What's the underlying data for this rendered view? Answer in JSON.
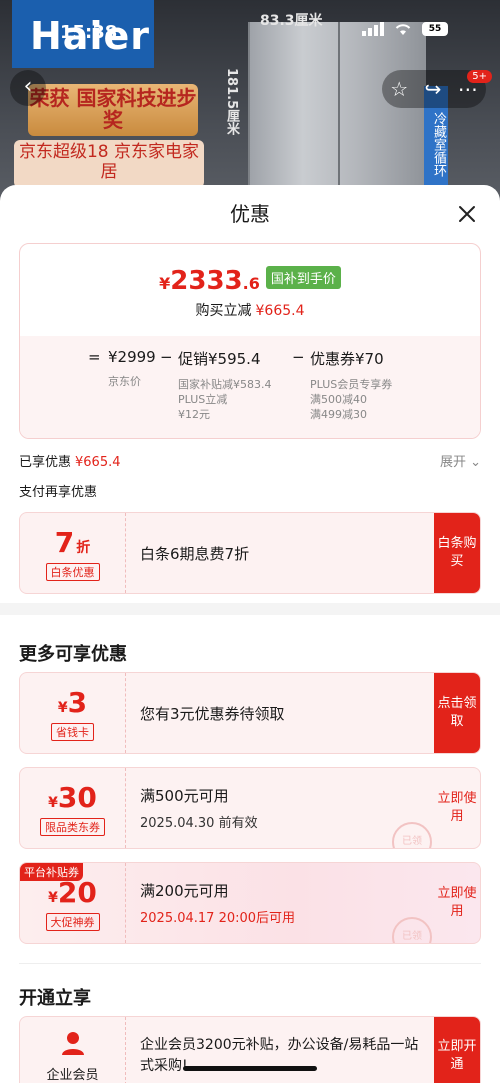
{
  "status_bar": {
    "time": "15:38",
    "battery": "55"
  },
  "background": {
    "brand_logo": "Haier",
    "dim_width": "83.3厘米",
    "dim_height": "181.5厘米",
    "award_text": "荣获 国家科技进步奖",
    "badge_text": "京东超级18 京东家电家居",
    "side_strip": "冷藏室循环",
    "cart_count": "5+"
  },
  "sheet": {
    "title": "优惠",
    "summary": {
      "currency": "¥",
      "price_int": "2333",
      "price_dec": ".6",
      "price_tag": "国补到手价",
      "save_label": "购买立减",
      "save_amount": "¥665.4",
      "formula": {
        "eq": "=",
        "base": "¥2999",
        "base_label": "京东价",
        "minus1": "−",
        "promo": "促销¥595.4",
        "promo_detail1": "国家补贴减¥583.4",
        "promo_detail2": "PLUS立减",
        "promo_detail3": "¥12元",
        "minus2": "−",
        "coupon": "优惠券¥70",
        "coupon_detail1": "PLUS会员专享券",
        "coupon_detail2": "满500减40",
        "coupon_detail3": "满499减30"
      }
    },
    "enjoyed_label": "已享优惠",
    "enjoyed_amount": "¥665.4",
    "expand_label": "展开",
    "pay_title": "支付再享优惠",
    "pay_card": {
      "value": "7",
      "unit": "折",
      "tag": "白条优惠",
      "text": "白条6期息费7折",
      "button": "白条购买"
    },
    "more_title": "更多可享优惠",
    "coupons": [
      {
        "symbol": "¥",
        "value": "3",
        "tag": "省钱卡",
        "main": "您有3元优惠券待领取",
        "sub": "",
        "button": "点击领取",
        "corner": "",
        "stamp": ""
      },
      {
        "symbol": "¥",
        "value": "30",
        "tag": "限品类东券",
        "main": "满500元可用",
        "sub": "2025.04.30 前有效",
        "button": "立即使用",
        "corner": "",
        "stamp": "已领"
      },
      {
        "symbol": "¥",
        "value": "20",
        "tag": "大促神券",
        "main": "满200元可用",
        "sub": "2025.04.17 20:00后可用",
        "button": "立即使用",
        "corner": "平台补贴券",
        "stamp": "已领"
      }
    ],
    "open_title": "开通立享",
    "enterprise": {
      "label": "企业会员",
      "text": "企业会员3200元补贴，办公设备/易耗品一站式采购!",
      "button": "立即开通"
    }
  },
  "colors": {
    "accent": "#e2231a",
    "green_tag": "#5bb14a",
    "card_bg": "#fdf2f2"
  }
}
